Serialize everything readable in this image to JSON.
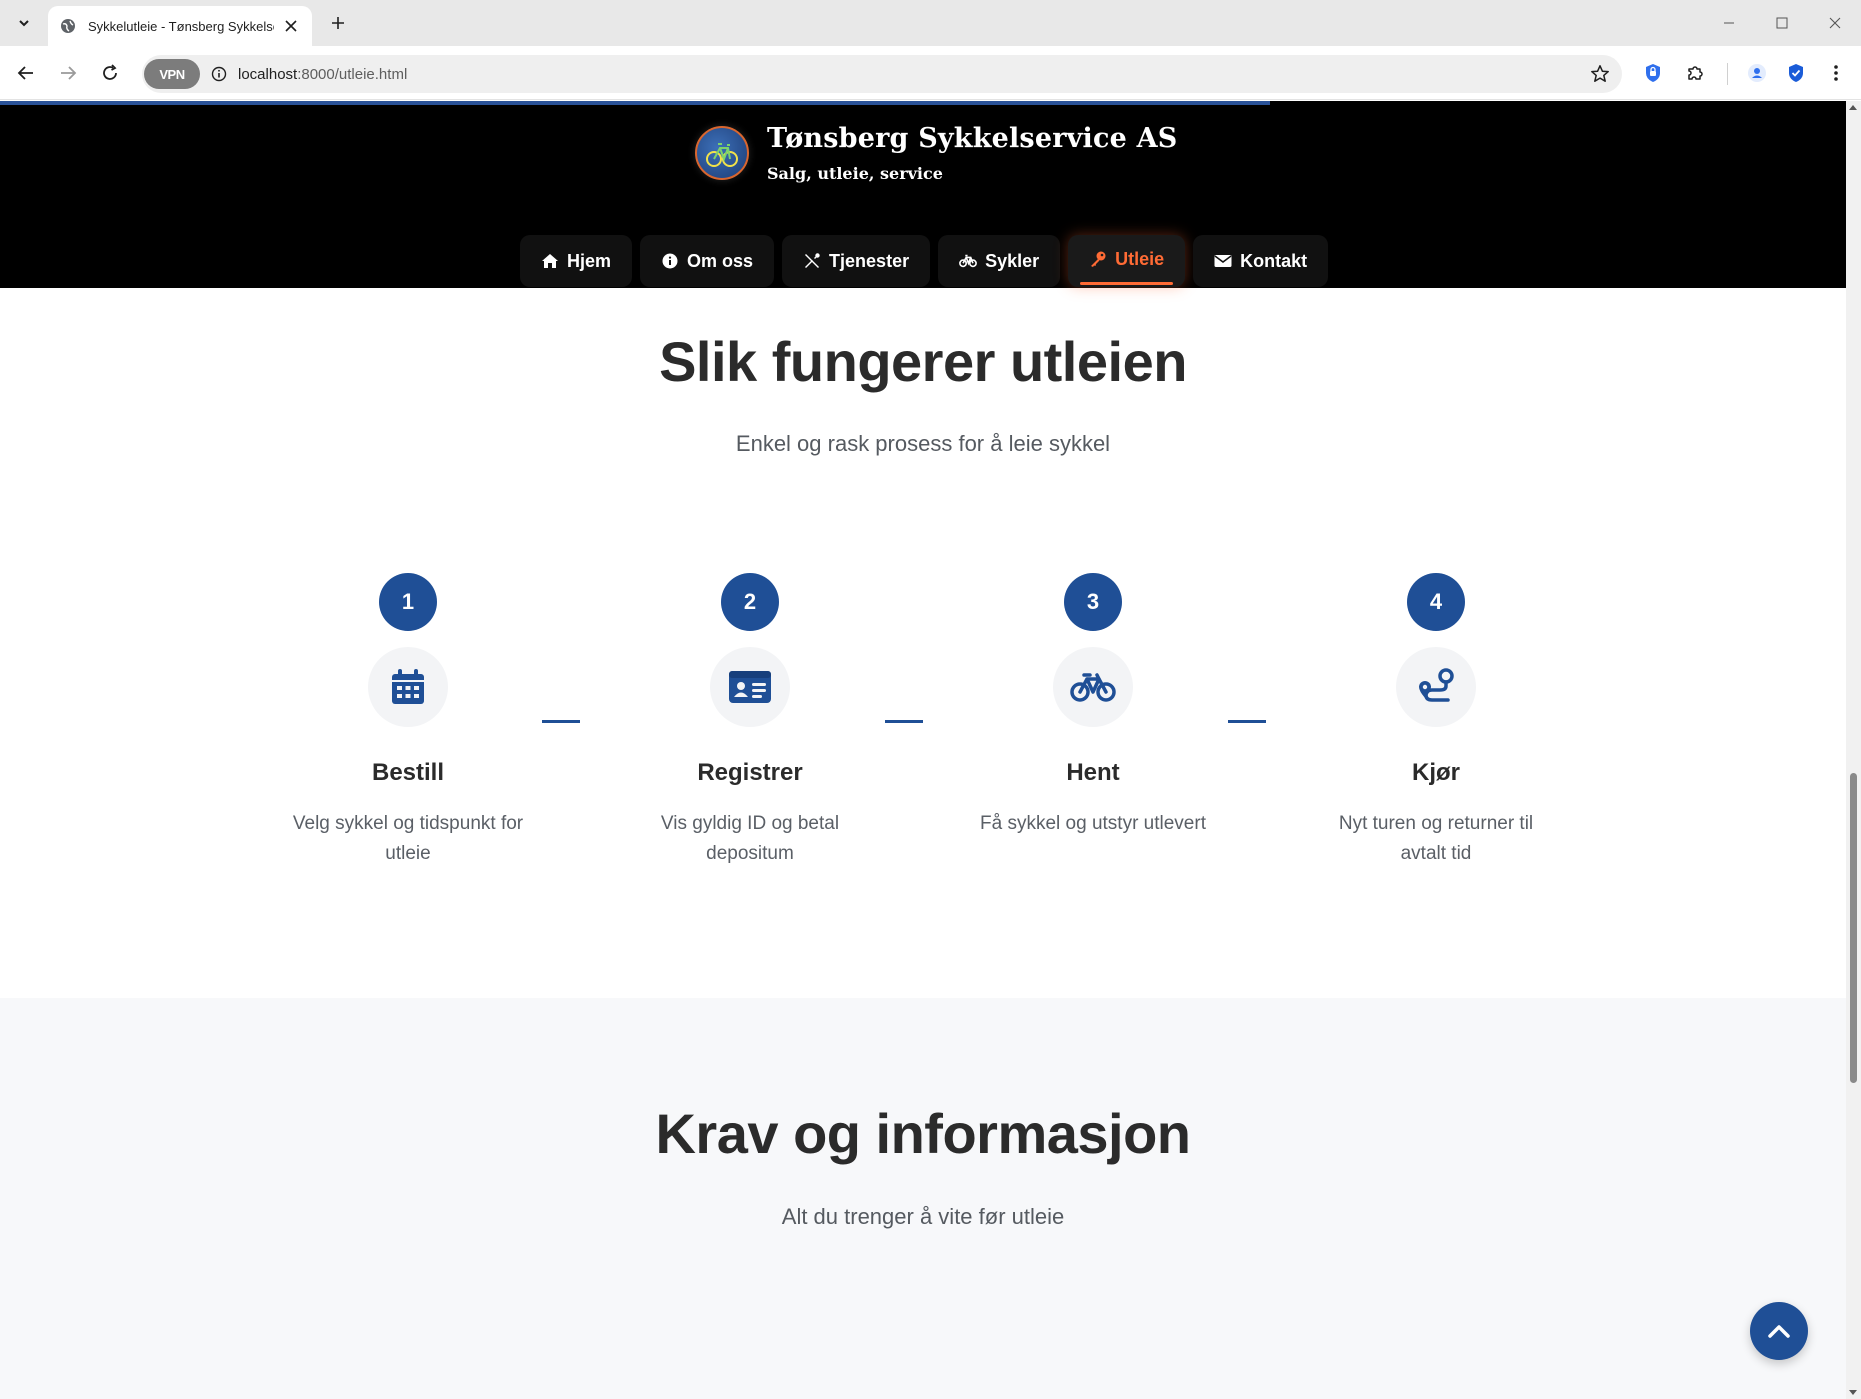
{
  "browser": {
    "tab_title": "Sykkelutleie - Tønsberg Sykkelservice AS",
    "url_host": "localhost",
    "url_rest": ":8000/utleie.html",
    "vpn_label": "VPN"
  },
  "site": {
    "name": "Tønsberg Sykkelservice AS",
    "tagline": "Salg, utleie, service",
    "nav": [
      {
        "label": "Hjem",
        "icon": "home-icon"
      },
      {
        "label": "Om oss",
        "icon": "info-icon"
      },
      {
        "label": "Tjenester",
        "icon": "tools-icon"
      },
      {
        "label": "Sykler",
        "icon": "bicycle-icon"
      },
      {
        "label": "Utleie",
        "icon": "key-icon",
        "active": true
      },
      {
        "label": "Kontakt",
        "icon": "envelope-icon"
      }
    ]
  },
  "how_it_works": {
    "title": "Slik fungerer utleien",
    "subtitle": "Enkel og rask prosess for å leie sykkel",
    "steps": [
      {
        "number": "1",
        "icon": "calendar-icon",
        "title": "Bestill",
        "description": "Velg sykkel og tidspunkt for utleie"
      },
      {
        "number": "2",
        "icon": "id-card-icon",
        "title": "Registrer",
        "description": "Vis gyldig ID og betal depositum"
      },
      {
        "number": "3",
        "icon": "bicycle-icon",
        "title": "Hent",
        "description": "Få sykkel og utstyr utlevert"
      },
      {
        "number": "4",
        "icon": "route-icon",
        "title": "Kjør",
        "description": "Nyt turen og returner til avtalt tid"
      }
    ]
  },
  "requirements": {
    "title": "Krav og informasjon",
    "subtitle": "Alt du trenger å vite før utleie"
  },
  "colors": {
    "primary": "#1f4f96",
    "accent": "#ff6b35",
    "header_bg": "#000000"
  }
}
